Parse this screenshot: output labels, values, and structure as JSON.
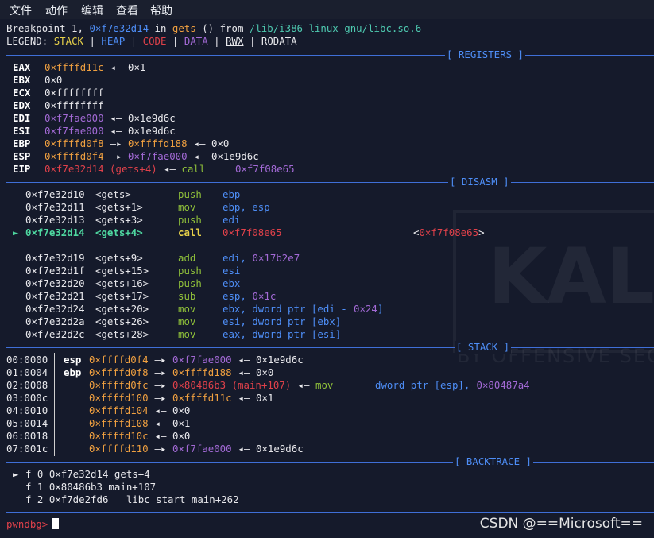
{
  "menu": [
    "文件",
    "动作",
    "编辑",
    "查看",
    "帮助"
  ],
  "header": {
    "bp_prefix": "Breakpoint 1, ",
    "bp_addr": "0×f7e32d14",
    "bp_in": " in ",
    "bp_func": "gets",
    "bp_args": " () from ",
    "bp_lib": "/lib/i386-linux-gnu/libc.so.6",
    "legend_label": "LEGEND: ",
    "legend": [
      "STACK",
      "HEAP",
      "CODE",
      "DATA",
      "RWX",
      "RODATA"
    ],
    "legend_sep": " | "
  },
  "sections": {
    "registers": "[ REGISTERS ]",
    "disasm": "[ DISASM ]",
    "stack": "[ STACK ]",
    "backtrace": "[ BACKTRACE ]"
  },
  "arrows": {
    "left": "◂—",
    "right": "—▸"
  },
  "registers": [
    {
      "name": "EAX",
      "v1": "0×ffffd11c",
      "c1": "stk",
      "a1": "◂—",
      "v2": "0×1",
      "c2": "num"
    },
    {
      "name": "EBX",
      "v1": "0×0",
      "c1": "num"
    },
    {
      "name": "ECX",
      "v1": "0×ffffffff",
      "c1": "num"
    },
    {
      "name": "EDX",
      "v1": "0×ffffffff",
      "c1": "num"
    },
    {
      "name": "EDI",
      "v1": "0×f7fae000",
      "c1": "dat",
      "a1": "◂—",
      "v2": "0×1e9d6c",
      "c2": "num"
    },
    {
      "name": "ESI",
      "v1": "0×f7fae000",
      "c1": "dat",
      "a1": "◂—",
      "v2": "0×1e9d6c",
      "c2": "num"
    },
    {
      "name": "EBP",
      "v1": "0×ffffd0f8",
      "c1": "stk",
      "a1": "—▸",
      "v2": "0×ffffd188",
      "c2": "stk",
      "a2": "◂—",
      "v3": "0×0",
      "c3": "num"
    },
    {
      "name": "ESP",
      "v1": "0×ffffd0f4",
      "c1": "stk",
      "a1": "—▸",
      "v2": "0×f7fae000",
      "c2": "dat",
      "a2": "◂—",
      "v3": "0×1e9d6c",
      "c3": "num"
    },
    {
      "name": "EIP",
      "v1": "0×f7e32d14 (gets+4)",
      "c1": "cod",
      "a1": "◂—",
      "v2": "call",
      "c2": "mn",
      "v3": "0×f7f08e65",
      "c3": "dat"
    }
  ],
  "disasm": [
    {
      "addr": "0×f7e32d10",
      "sym": "<gets>",
      "mn": "push",
      "op": "ebp"
    },
    {
      "addr": "0×f7e32d11",
      "sym": "<gets+1>",
      "mn": "mov",
      "op": "ebp, esp"
    },
    {
      "addr": "0×f7e32d13",
      "sym": "<gets+3>",
      "mn": "push",
      "op": "edi"
    },
    {
      "addr": "0×f7e32d14",
      "sym": "<gets+4>",
      "mn": "call",
      "op": "0×f7f08e65",
      "target": "<0×f7f08e65>",
      "current": true,
      "marker": "►"
    },
    {
      "gap": true
    },
    {
      "addr": "0×f7e32d19",
      "sym": "<gets+9>",
      "mn": "add",
      "op": "edi, ",
      "opnum": "0×17b2e7"
    },
    {
      "addr": "0×f7e32d1f",
      "sym": "<gets+15>",
      "mn": "push",
      "op": "esi"
    },
    {
      "addr": "0×f7e32d20",
      "sym": "<gets+16>",
      "mn": "push",
      "op": "ebx"
    },
    {
      "addr": "0×f7e32d21",
      "sym": "<gets+17>",
      "mn": "sub",
      "op": "esp, ",
      "opnum": "0×1c"
    },
    {
      "addr": "0×f7e32d24",
      "sym": "<gets+20>",
      "mn": "mov",
      "op": "ebx, dword ptr [edi - ",
      "opnum": "0×24",
      "opend": "]"
    },
    {
      "addr": "0×f7e32d2a",
      "sym": "<gets+26>",
      "mn": "mov",
      "op": "esi, dword ptr [ebx]"
    },
    {
      "addr": "0×f7e32d2c",
      "sym": "<gets+28>",
      "mn": "mov",
      "op": "eax, dword ptr [esi]"
    }
  ],
  "stack": [
    {
      "idx": "00:0000",
      "reg": "esp",
      "addr": "0×ffffd0f4",
      "a1": "—▸",
      "v1": "0×f7fae000",
      "c1": "dat",
      "a2": "◂—",
      "v2": "0×1e9d6c",
      "c2": "num"
    },
    {
      "idx": "01:0004",
      "reg": "ebp",
      "addr": "0×ffffd0f8",
      "a1": "—▸",
      "v1": "0×ffffd188",
      "c1": "stk",
      "a2": "◂—",
      "v2": "0×0",
      "c2": "num"
    },
    {
      "idx": "02:0008",
      "reg": "",
      "addr": "0×ffffd0fc",
      "a1": "—▸",
      "v1": "0×80486b3 (main+107)",
      "c1": "cod",
      "a2": "◂—",
      "v2": "mov",
      "c2": "mn",
      "v3": "dword ptr [esp], ",
      "v4": "0×80487a4"
    },
    {
      "idx": "03:000c",
      "reg": "",
      "addr": "0×ffffd100",
      "a1": "—▸",
      "v1": "0×ffffd11c",
      "c1": "stk",
      "a2": "◂—",
      "v2": "0×1",
      "c2": "num"
    },
    {
      "idx": "04:0010",
      "reg": "",
      "addr": "0×ffffd104",
      "a1": "◂—",
      "v1": "0×0",
      "c1": "num"
    },
    {
      "idx": "05:0014",
      "reg": "",
      "addr": "0×ffffd108",
      "a1": "◂—",
      "v1": "0×1",
      "c1": "num"
    },
    {
      "idx": "06:0018",
      "reg": "",
      "addr": "0×ffffd10c",
      "a1": "◂—",
      "v1": "0×0",
      "c1": "num"
    },
    {
      "idx": "07:001c",
      "reg": "",
      "addr": "0×ffffd110",
      "a1": "—▸",
      "v1": "0×f7fae000",
      "c1": "dat",
      "a2": "◂—",
      "v2": "0×1e9d6c",
      "c2": "num"
    }
  ],
  "backtrace": [
    {
      "marker": "►",
      "text": "f 0 0×f7e32d14 gets+4"
    },
    {
      "marker": "",
      "text": "f 1 0×80486b3 main+107"
    },
    {
      "marker": "",
      "text": "f 2 0×f7de2fd6 __libc_start_main+262"
    }
  ],
  "prompt": "pwndbg>",
  "watermark": {
    "brand": "KAL",
    "tagline": "BY OFFENSIVE SEC"
  },
  "csdn_mark": "CSDN @==Microsoft=="
}
